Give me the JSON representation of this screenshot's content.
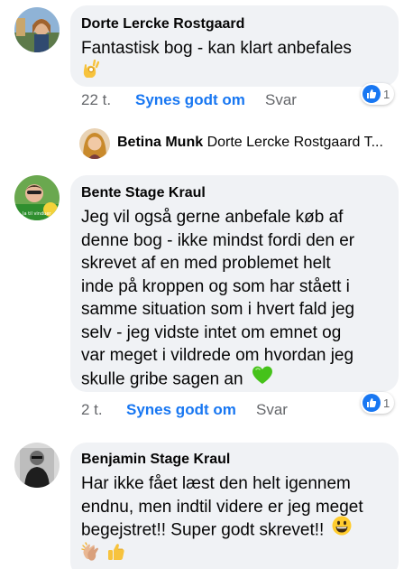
{
  "comments": [
    {
      "author": "Dorte Lercke Rostgaard",
      "lines": [
        "Fantastisk bog - kan klart anbefales"
      ],
      "emoji": "ok-hand",
      "time": "22 t.",
      "like_label": "Synes godt om",
      "reply_label": "Svar",
      "reaction_count": "1"
    },
    {
      "author": "Bente Stage Kraul",
      "lines": [
        "Jeg vil også gerne anbefale køb af",
        "denne bog - ikke mindst fordi den er",
        "skrevet af en med problemet helt",
        "inde på kroppen og som har ståett i",
        "samme situation som i hvert fald jeg",
        "selv - jeg vidste intet om emnet og",
        "var meget i vildrede om hvordan jeg",
        "skulle gribe sagen an"
      ],
      "emoji": "green-heart",
      "time": "2 t.",
      "like_label": "Synes godt om",
      "reply_label": "Svar",
      "reaction_count": "1"
    },
    {
      "author": "Benjamin Stage Kraul",
      "lines": [
        "Har ikke fået læst den helt igennem",
        "endnu, men indtil videre er jeg meget",
        "begejstret!!  Super godt skrevet!!"
      ],
      "emoji": "grinning-face",
      "extra_emoji": [
        "clapping-hands",
        "thumbs-up"
      ]
    }
  ],
  "reply_preview": {
    "name": "Betina Munk",
    "text": "Dorte Lercke Rostgaard T..."
  },
  "colors": {
    "bubble": "#f0f2f5",
    "link": "#1877f2",
    "muted": "#65676b"
  }
}
